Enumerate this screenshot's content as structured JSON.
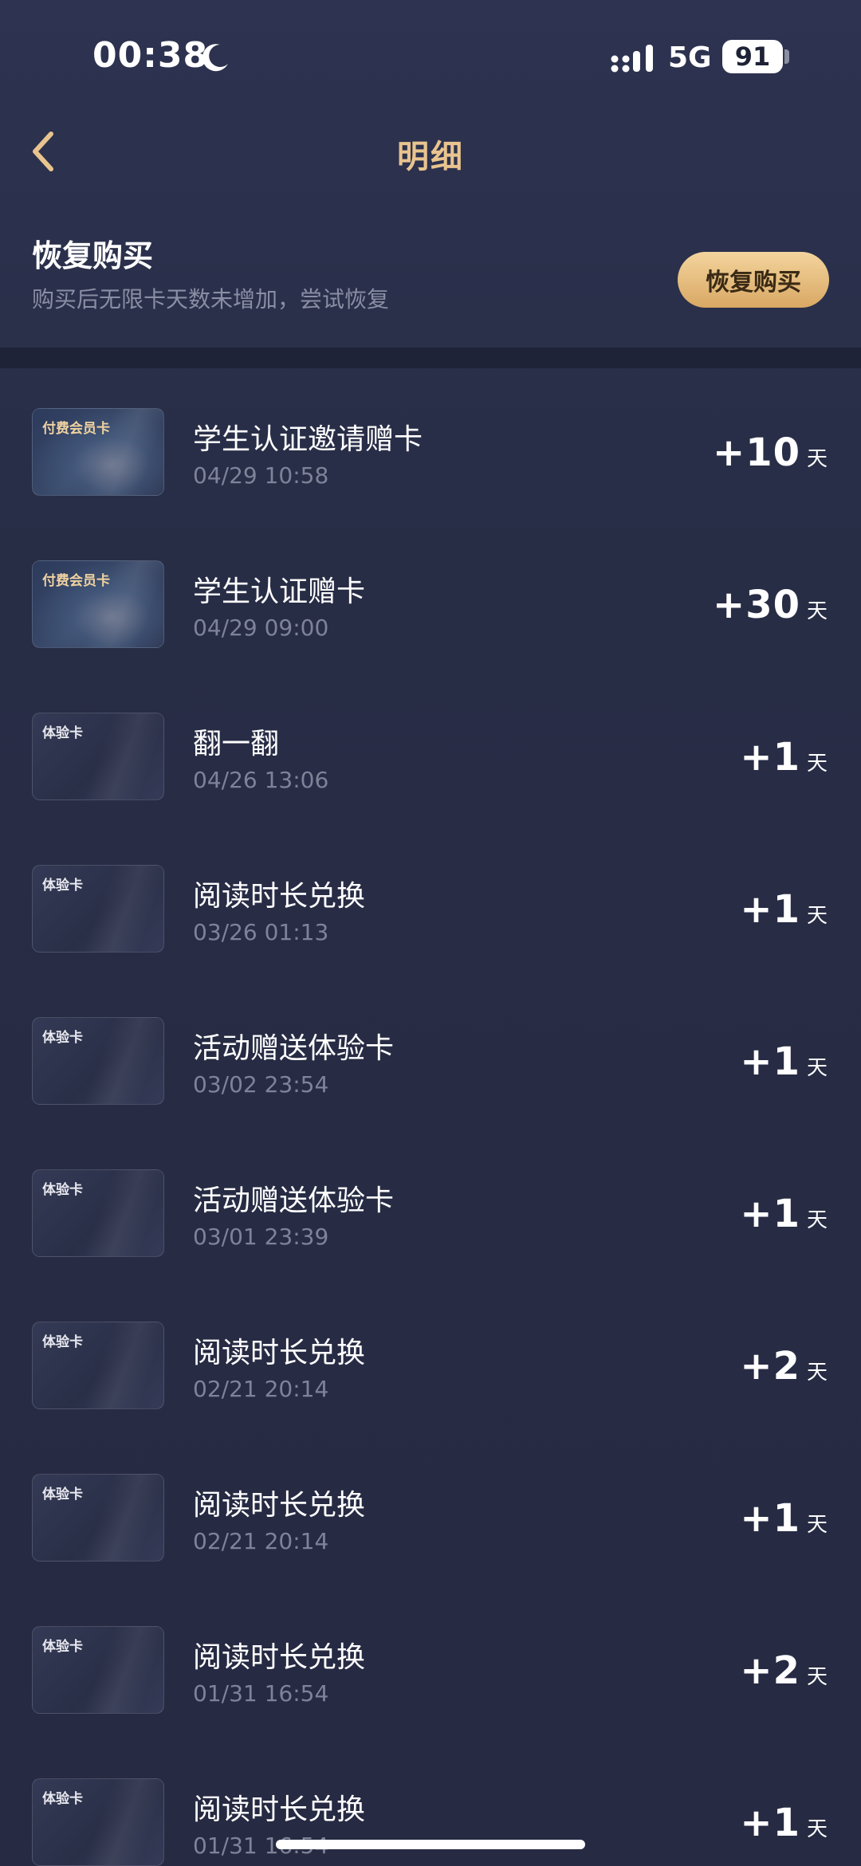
{
  "status_bar": {
    "time": "00:38",
    "network": "5G",
    "battery": "91"
  },
  "nav": {
    "title": "明细",
    "back_icon": "chevron-left-icon"
  },
  "restore": {
    "title": "恢复购买",
    "subtitle": "购买后无限卡天数未增加，尝试恢复",
    "button_label": "恢复购买"
  },
  "colors": {
    "accent_gold": "#e9c48f",
    "background": "#282d46",
    "secondary_text": "#7e8399"
  },
  "items": [
    {
      "card": "付费会员卡",
      "card_type": "vip",
      "title": "学生认证邀请赠卡",
      "date": "04/29 10:58",
      "amount": "+10",
      "unit": "天"
    },
    {
      "card": "付费会员卡",
      "card_type": "vip",
      "title": "学生认证赠卡",
      "date": "04/29 09:00",
      "amount": "+30",
      "unit": "天"
    },
    {
      "card": "体验卡",
      "card_type": "trial",
      "title": "翻一翻",
      "date": "04/26 13:06",
      "amount": "+1",
      "unit": "天"
    },
    {
      "card": "体验卡",
      "card_type": "trial",
      "title": "阅读时长兑换",
      "date": "03/26 01:13",
      "amount": "+1",
      "unit": "天"
    },
    {
      "card": "体验卡",
      "card_type": "trial",
      "title": "活动赠送体验卡",
      "date": "03/02 23:54",
      "amount": "+1",
      "unit": "天"
    },
    {
      "card": "体验卡",
      "card_type": "trial",
      "title": "活动赠送体验卡",
      "date": "03/01 23:39",
      "amount": "+1",
      "unit": "天"
    },
    {
      "card": "体验卡",
      "card_type": "trial",
      "title": "阅读时长兑换",
      "date": "02/21 20:14",
      "amount": "+2",
      "unit": "天"
    },
    {
      "card": "体验卡",
      "card_type": "trial",
      "title": "阅读时长兑换",
      "date": "02/21 20:14",
      "amount": "+1",
      "unit": "天"
    },
    {
      "card": "体验卡",
      "card_type": "trial",
      "title": "阅读时长兑换",
      "date": "01/31 16:54",
      "amount": "+2",
      "unit": "天"
    },
    {
      "card": "体验卡",
      "card_type": "trial",
      "title": "阅读时长兑换",
      "date": "01/31 16:54",
      "amount": "+1",
      "unit": "天"
    }
  ]
}
